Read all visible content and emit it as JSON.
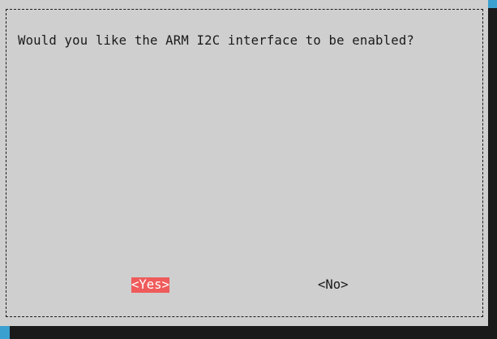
{
  "dialog": {
    "prompt": "Would you like the ARM I2C interface to be enabled?",
    "buttons": {
      "yes_label": "<Yes>",
      "no_label": "<No>",
      "selected": "yes"
    }
  },
  "colors": {
    "screen_background": "#3aa0cf",
    "dialog_background": "#cfcfcf",
    "selected_button": "#ef5b5b",
    "shadow": "#1a1a1a"
  }
}
